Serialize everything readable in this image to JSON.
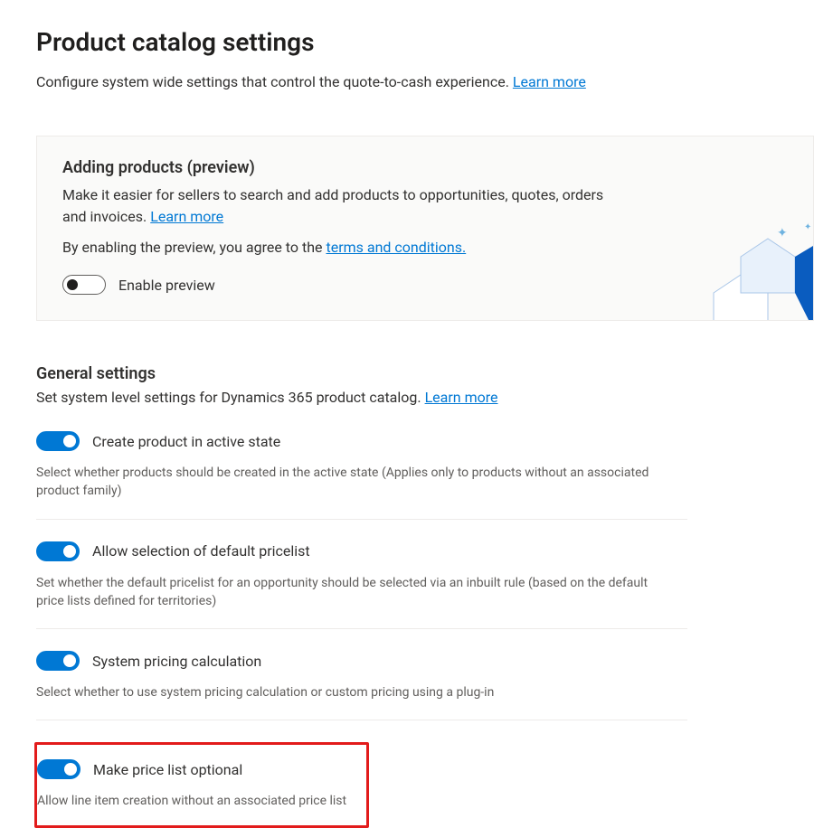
{
  "page": {
    "title": "Product catalog settings",
    "subtitle": "Configure system wide settings that control the quote-to-cash experience.",
    "learn_more": "Learn more"
  },
  "callout": {
    "title": "Adding products (preview)",
    "line1": "Make it easier for sellers to search and add products to opportunities, quotes, orders and invoices.",
    "learn_more": "Learn more",
    "line2_prefix": "By enabling the preview, you agree to the",
    "terms": "terms and conditions.",
    "enable_preview_label": "Enable preview"
  },
  "general": {
    "title": "General settings",
    "subtitle": "Set system level settings for Dynamics 365 product catalog.",
    "learn_more": "Learn more",
    "settings": [
      {
        "label": "Create product in active state",
        "desc": "Select whether products should be created in the active state (Applies only to products without an associated product family)"
      },
      {
        "label": "Allow selection of default pricelist",
        "desc": "Set whether the default pricelist for an opportunity should be selected via an inbuilt rule (based on the default price lists defined for territories)"
      },
      {
        "label": "System pricing calculation",
        "desc": "Select whether to use system pricing calculation or custom pricing using a plug-in"
      },
      {
        "label": "Make price list optional",
        "desc": "Allow line item creation without an associated price list"
      }
    ]
  }
}
